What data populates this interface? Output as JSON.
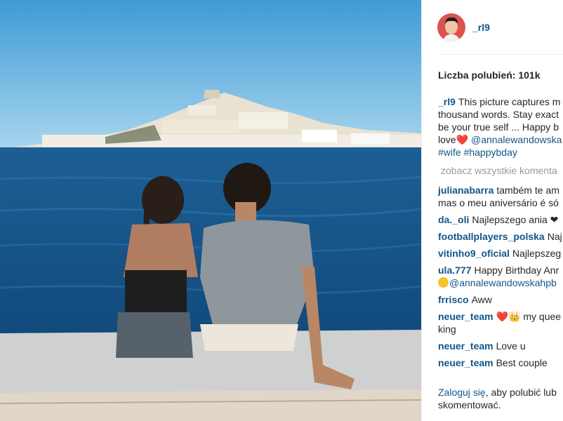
{
  "post": {
    "username": "_rl9",
    "likes_text": "Liczba polubień: 101k",
    "caption": {
      "user": "_rl9",
      "line1": "This picture captures m",
      "line2": "thousand words. Stay exact",
      "line3": "be your true self ... Happy b",
      "line4_text": "love",
      "line4_heart": "❤️",
      "line4_mention": "@annalewandowska",
      "line5_tags": "#wife #happybday"
    },
    "view_all_comments": "zobacz wszystkie komenta"
  },
  "comments": [
    {
      "user": "julianabarra",
      "line1": "também te am",
      "line2": "mas o meu aniversário é só"
    },
    {
      "user": "da._oli",
      "text": "Najlepszego ania ❤"
    },
    {
      "user": "footballplayers_polska",
      "text": "Naj"
    },
    {
      "user": "vitinho9_oficial",
      "text": "Najlepszeg"
    },
    {
      "user": "ula.777",
      "text": "Happy Birthday Anr",
      "line2_mention": "@annalewandowskahpb"
    },
    {
      "user": "frrisco",
      "text": "Aww"
    },
    {
      "user": "neuer_team",
      "emoji": "❤️👑",
      "text": "my quee",
      "line2": "king"
    },
    {
      "user": "neuer_team",
      "text": "Love u"
    },
    {
      "user": "neuer_team",
      "text": "Best couple"
    }
  ],
  "login_prompt": {
    "link": "Zaloguj się",
    "text": ", aby polubić lub skomentować."
  },
  "colors": {
    "link": "#125688",
    "muted": "#999999",
    "heart": "#e0245e"
  },
  "icons": {
    "avatar": "avatar-illustration"
  }
}
